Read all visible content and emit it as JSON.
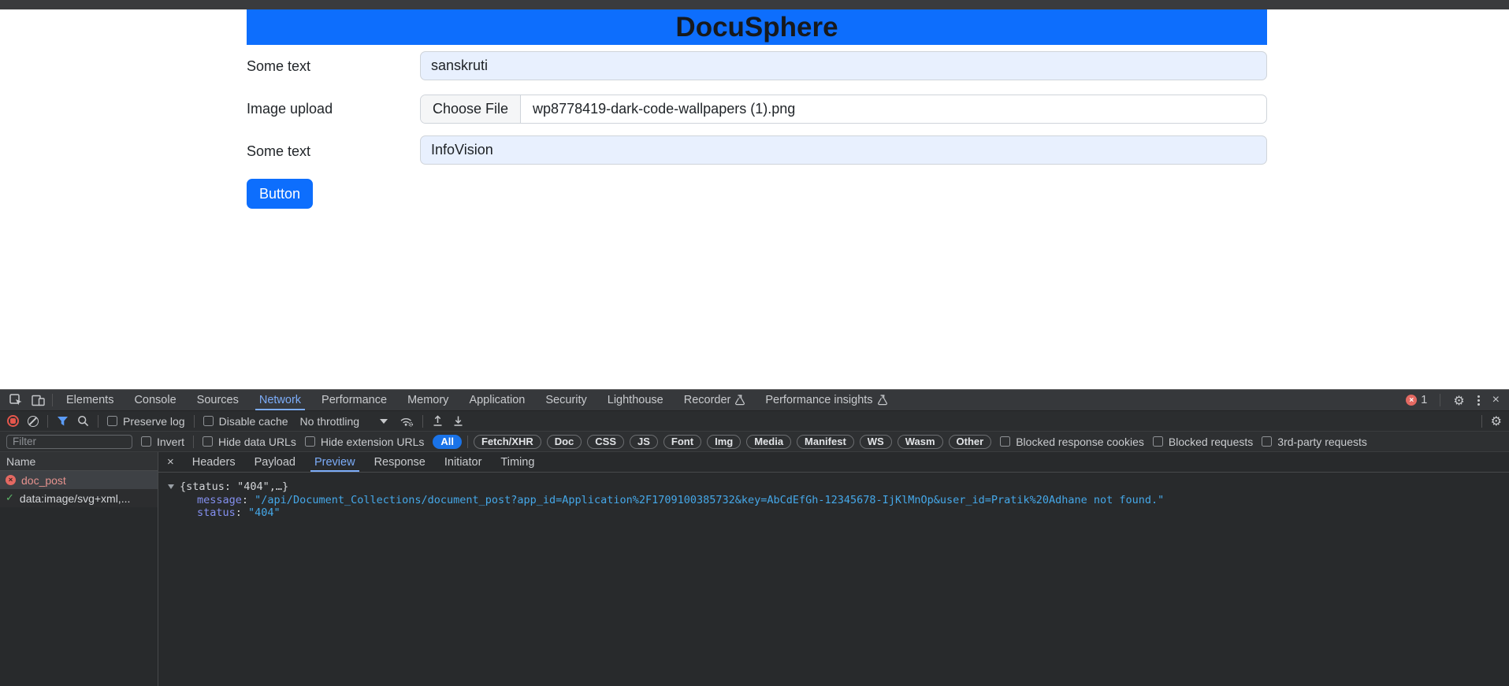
{
  "page": {
    "title": "DocuSphere",
    "form": {
      "rows": [
        {
          "label": "Some text",
          "value": "sanskruti"
        },
        {
          "label": "Image upload",
          "button": "Choose File",
          "filename": "wp8778419-dark-code-wallpapers (1).png"
        },
        {
          "label": "Some text",
          "value": "InfoVision"
        }
      ],
      "submit_label": "Button"
    },
    "colors": {
      "banner": "#0d6efd",
      "autofill_bg": "#e8f0fe",
      "button": "#0d6efd"
    }
  },
  "devtools": {
    "tabs": [
      "Elements",
      "Console",
      "Sources",
      "Network",
      "Performance",
      "Memory",
      "Application",
      "Security",
      "Lighthouse",
      "Recorder",
      "Performance insights"
    ],
    "active_tab": "Network",
    "error_badge_count": "1",
    "close_label": "×",
    "toolbar": {
      "preserve_log": "Preserve log",
      "disable_cache": "Disable cache",
      "throttling": "No throttling"
    },
    "filter": {
      "placeholder": "Filter",
      "invert": "Invert",
      "hide_data_urls": "Hide data URLs",
      "hide_extension_urls": "Hide extension URLs",
      "pills": [
        "All",
        "Fetch/XHR",
        "Doc",
        "CSS",
        "JS",
        "Font",
        "Img",
        "Media",
        "Manifest",
        "WS",
        "Wasm",
        "Other"
      ],
      "active_pill": "All",
      "blocked_response_cookies": "Blocked response cookies",
      "blocked_requests": "Blocked requests",
      "third_party_requests": "3rd-party requests"
    },
    "requests": {
      "name_header": "Name",
      "rows": [
        {
          "name": "doc_post",
          "status": "error"
        },
        {
          "name": "data:image/svg+xml,...",
          "status": "ok"
        }
      ]
    },
    "detail_tabs": [
      "Headers",
      "Payload",
      "Preview",
      "Response",
      "Initiator",
      "Timing"
    ],
    "active_detail_tab": "Preview",
    "preview": {
      "summary": "{status: \"404\",…}",
      "message_key": "message",
      "message_value": "\"/api/Document_Collections/document_post?app_id=Application%2F1709100385732&key=AbCdEfGh-12345678-IjKlMnOp&user_id=Pratik%20Adhane not found.\"",
      "status_key": "status",
      "status_value": "\"404\""
    },
    "colors": {
      "accent": "#7cacf8",
      "error": "#e46962",
      "success": "#5cb568",
      "pill_active": "#1a73e8"
    }
  }
}
